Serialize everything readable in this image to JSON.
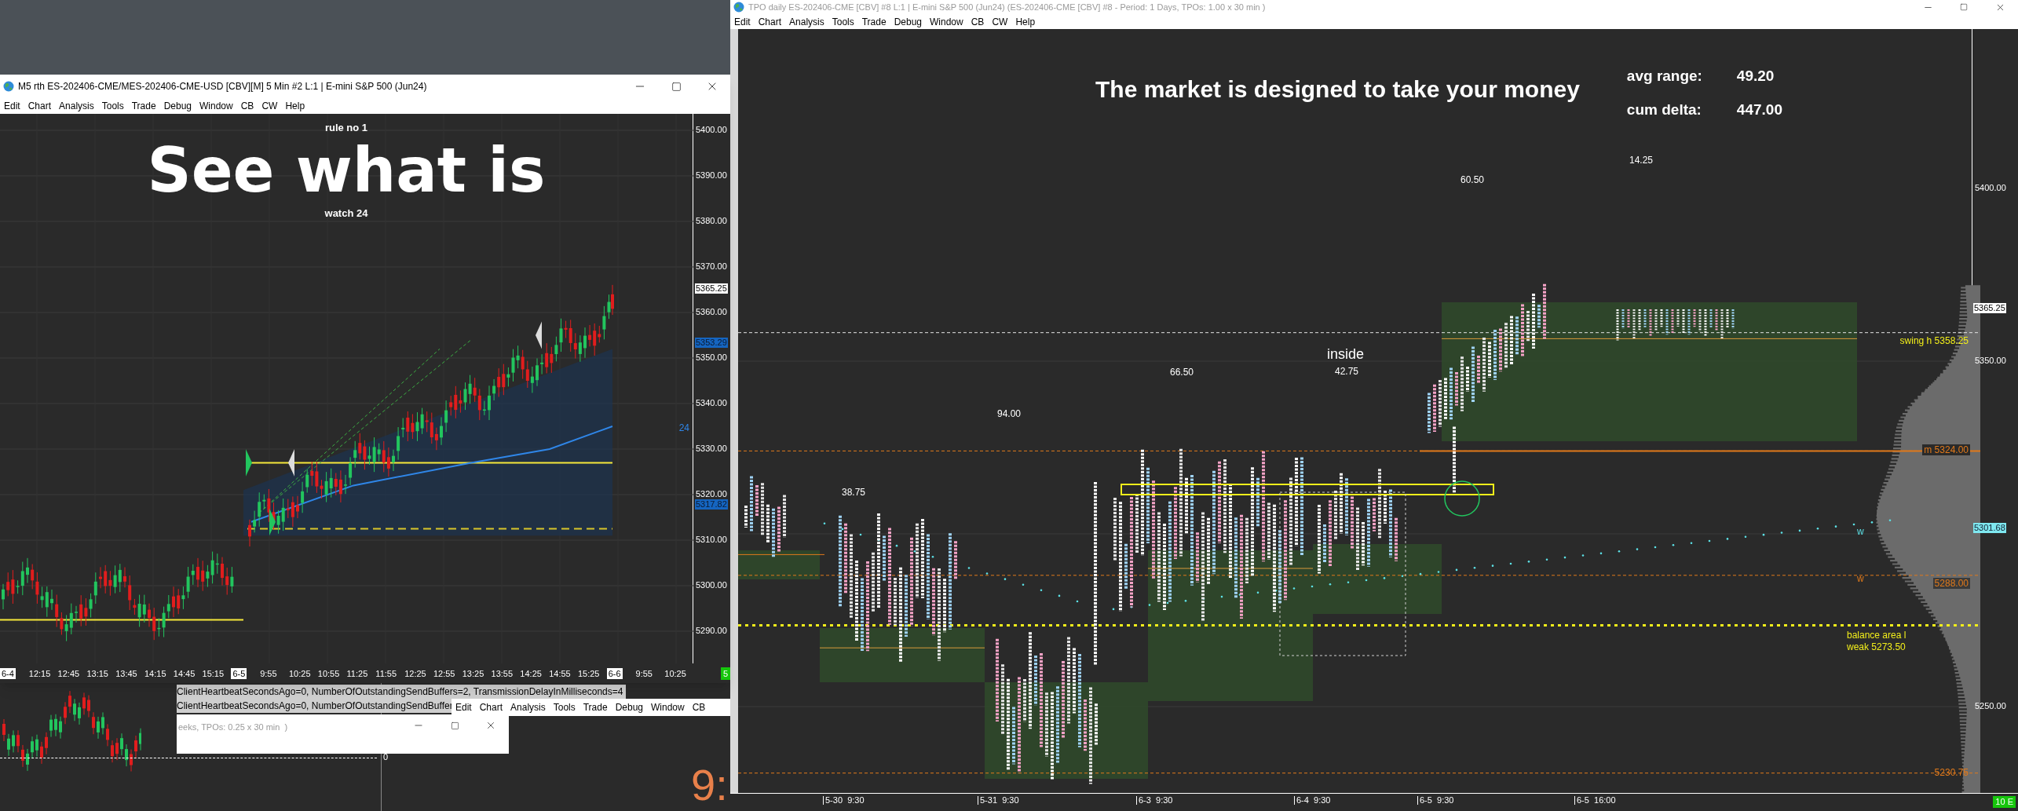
{
  "left_window": {
    "title": "M5 rth ES-202406-CME/MES-202406-CME-USD [CBV][M]  5 Min  #2 L:1 | E-mini S&P 500 (Jun24)",
    "menu": [
      "Edit",
      "Chart",
      "Analysis",
      "Tools",
      "Trade",
      "Debug",
      "Window",
      "CB",
      "CW",
      "Help"
    ],
    "caption_top": "rule no 1",
    "headline": "See what is",
    "caption_bottom": "watch 24",
    "line_label": "24",
    "price_ticks": [
      "5400.00",
      "5390.00",
      "5380.00",
      "5370.00",
      "5360.00",
      "5350.00",
      "5340.00",
      "5330.00",
      "5320.00",
      "5310.00",
      "5300.00",
      "5290.00"
    ],
    "price_markers": [
      {
        "text": "5365.25",
        "kind": "last"
      },
      {
        "text": "5353.29",
        "kind": "study"
      },
      {
        "text": "5317.82",
        "kind": "study"
      }
    ],
    "time_labels": [
      {
        "text": "6-4",
        "kind": "date"
      },
      {
        "text": "12:15",
        "kind": "time"
      },
      {
        "text": "12:45",
        "kind": "time"
      },
      {
        "text": "13:15",
        "kind": "time"
      },
      {
        "text": "13:45",
        "kind": "time"
      },
      {
        "text": "14:15",
        "kind": "time"
      },
      {
        "text": "14:45",
        "kind": "time"
      },
      {
        "text": "15:15",
        "kind": "time"
      },
      {
        "text": "6-5",
        "kind": "date"
      },
      {
        "text": "9:55",
        "kind": "time"
      },
      {
        "text": "10:25",
        "kind": "time"
      },
      {
        "text": "10:55",
        "kind": "time"
      },
      {
        "text": "11:25",
        "kind": "time"
      },
      {
        "text": "11:55",
        "kind": "time"
      },
      {
        "text": "12:25",
        "kind": "time"
      },
      {
        "text": "12:55",
        "kind": "time"
      },
      {
        "text": "13:25",
        "kind": "time"
      },
      {
        "text": "13:55",
        "kind": "time"
      },
      {
        "text": "14:25",
        "kind": "time"
      },
      {
        "text": "14:55",
        "kind": "time"
      },
      {
        "text": "15:25",
        "kind": "time"
      },
      {
        "text": "6-6",
        "kind": "date"
      },
      {
        "text": "9:55",
        "kind": "time"
      },
      {
        "text": "10:25",
        "kind": "time"
      }
    ],
    "status_badge": "5"
  },
  "right_window": {
    "title": "TPO daily ES-202406-CME [CBV] #8 L:1 | E-mini S&P 500 (Jun24) (ES-202406-CME [CBV] #8 - Period: 1 Days, TPOs: 1.00 x 30 min )",
    "menu": [
      "Edit",
      "Chart",
      "Analysis",
      "Tools",
      "Trade",
      "Debug",
      "Window",
      "CB",
      "CW",
      "Help"
    ],
    "headline": "The market is designed to take your money",
    "stats": [
      {
        "label": "avg range:",
        "value": "49.20"
      },
      {
        "label": "cum delta:",
        "value": "447.00"
      }
    ],
    "price_ticks": [
      "5400.00",
      "5350.00",
      "5250.00"
    ],
    "price_markers": [
      {
        "text": "5365.25",
        "kind": "last"
      },
      {
        "text": "5301.68",
        "kind": "study"
      }
    ],
    "levels": [
      {
        "kind": "swing",
        "label": "swing h",
        "price": "5358.25"
      },
      {
        "kind": "magnet",
        "label": "m",
        "price": "5324.00"
      },
      {
        "kind": "support",
        "price": "5288.00"
      },
      {
        "kind": "balance",
        "label": "balance area l",
        "note": "weak",
        "price": "5273.50"
      },
      {
        "kind": "low",
        "price": "5230.75"
      }
    ],
    "vwap_labels": [
      {
        "text": "w",
        "color": "#5ce1e6"
      },
      {
        "text": "w",
        "color": "#e0791b"
      }
    ],
    "annotations": [
      {
        "text": "14.25",
        "kind": "value"
      },
      {
        "text": "60.50",
        "kind": "value"
      },
      {
        "text": "inside",
        "kind": "tag"
      },
      {
        "text": "66.50",
        "kind": "value"
      },
      {
        "text": "42.75",
        "kind": "value"
      },
      {
        "text": "94.00",
        "kind": "value"
      },
      {
        "text": "38.75",
        "kind": "value"
      }
    ],
    "time_labels": [
      "5-30  9:30",
      "5-31  9:30",
      "6-3  9:30",
      "6-4  9:30",
      "6-5  9:30",
      "6-5  16:00"
    ],
    "status_badge": "10 E"
  },
  "background_chart": {
    "axis_label": "0"
  },
  "log_lines": [
    "ClientHeartbeatSecondsAgo=0, NumberOfOutstandingSendBuffers=2, TransmissionDelayInMilliseconds=4",
    "ClientHeartbeatSecondsAgo=0, NumberOfOutstandingSendBuffer"
  ],
  "menu_fragment": [
    "Edit",
    "Chart",
    "Analysis",
    "Tools",
    "Trade",
    "Debug",
    "Window",
    "CB"
  ],
  "small_window": {
    "title": "eeks, TPOs: 0.25 x 30 min  )"
  },
  "clock_fragment": "9:"
}
